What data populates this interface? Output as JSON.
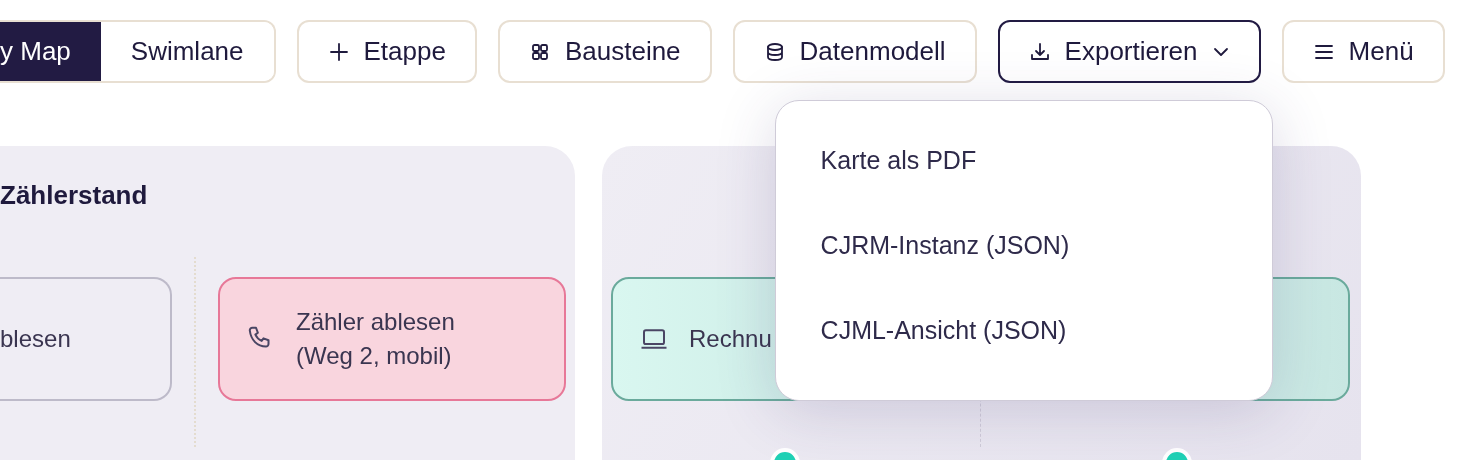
{
  "view_switch": [
    {
      "label": "y Map",
      "selected": true
    },
    {
      "label": "Swimlane",
      "selected": false
    }
  ],
  "toolbar": [
    {
      "label": "Etappe",
      "kind": "add",
      "expanded": false
    },
    {
      "label": "Bausteine",
      "kind": "blocks",
      "expanded": false
    },
    {
      "label": "Datenmodell",
      "kind": "data",
      "expanded": false
    },
    {
      "label": "Exportieren",
      "kind": "export",
      "expanded": true,
      "menu": [
        "Karte als PDF",
        "CJRM-Instanz (JSON)",
        "CJML-Ansicht (JSON)"
      ]
    },
    {
      "label": "Menü",
      "kind": "menu",
      "expanded": false
    }
  ],
  "lanes": [
    {
      "title": "Zählerstand",
      "cards": [
        {
          "text": "blesen",
          "kind": "neutral",
          "connector": false
        },
        {
          "text": "Zähler ablesen\n(Weg 2, mobil)",
          "kind": "call",
          "connector": false
        }
      ]
    },
    {
      "cards": [
        {
          "text": "Rechnu",
          "kind": "online",
          "connector": true
        },
        {
          "kind": "online",
          "connector": true
        }
      ]
    }
  ]
}
